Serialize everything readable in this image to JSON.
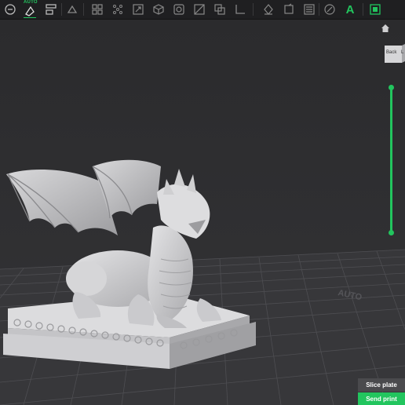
{
  "toolbar": {
    "auto_label": "AUTO",
    "buttons": [
      {
        "name": "open-icon"
      },
      {
        "name": "auto-orient-icon"
      },
      {
        "name": "arrange-icon"
      },
      {
        "name": "lay-on-face-icon"
      },
      {
        "name": "grid-layout-icon"
      },
      {
        "name": "dots-grid-icon"
      },
      {
        "name": "scale-icon"
      },
      {
        "name": "cube-icon"
      },
      {
        "name": "hollow-icon"
      },
      {
        "name": "cut-icon"
      },
      {
        "name": "boolean-icon"
      },
      {
        "name": "ruler-icon"
      },
      {
        "name": "support-icon"
      },
      {
        "name": "seam-icon"
      },
      {
        "name": "layers-icon"
      },
      {
        "name": "paint-icon"
      },
      {
        "name": "text-icon"
      },
      {
        "name": "assembly-icon"
      }
    ],
    "text_tool_glyph": "A",
    "accent": "#22c55e"
  },
  "viewport": {
    "view_cube_label": "Back",
    "view_cube_side": "L",
    "bed_text": "AUTO",
    "model_color": "#c9c9cb"
  },
  "actions": {
    "slice_label": "Slice plate",
    "send_label": "Send print"
  }
}
